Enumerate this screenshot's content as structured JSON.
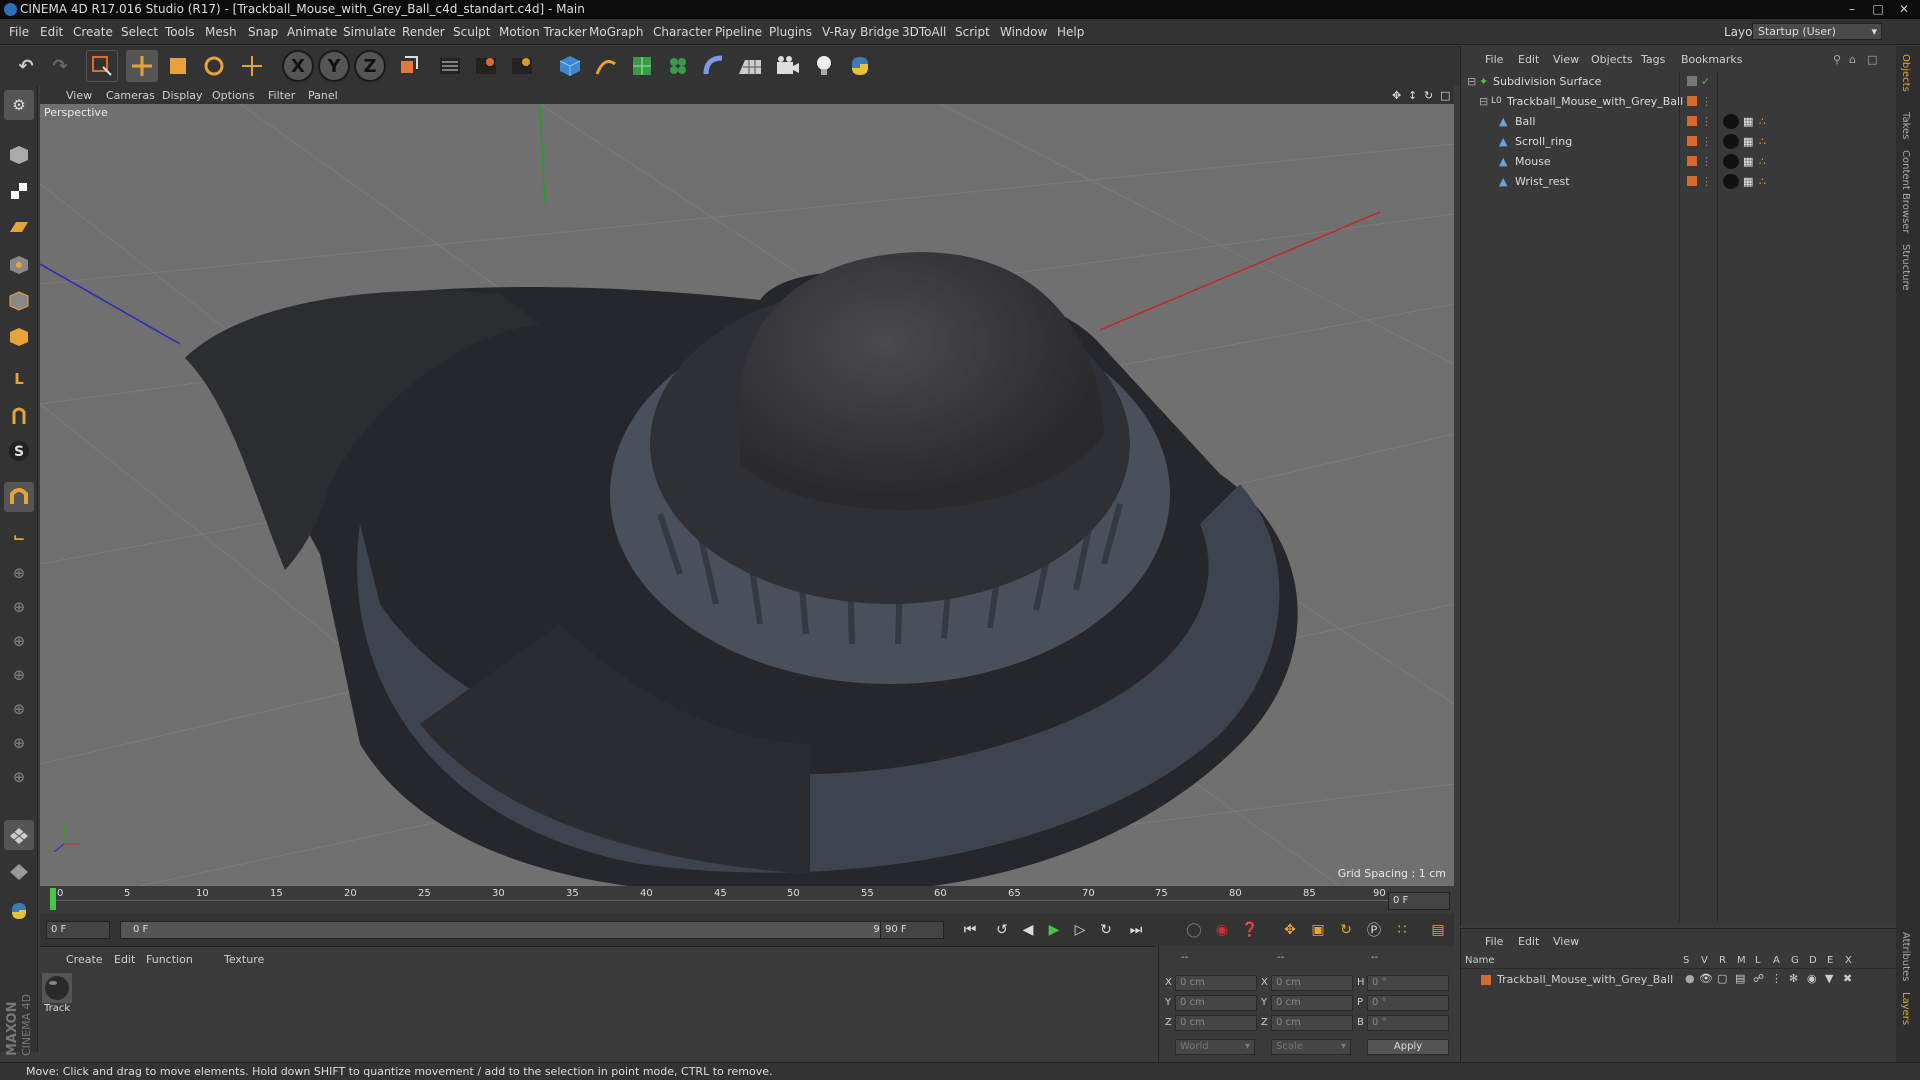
{
  "window": {
    "title": "CINEMA 4D R17.016 Studio (R17) - [Trackball_Mouse_with_Grey_Ball_c4d_standart.c4d] - Main",
    "controls": [
      "–",
      "□",
      "✕"
    ]
  },
  "menubar": {
    "items": [
      "File",
      "Edit",
      "Create",
      "Select",
      "Tools",
      "Mesh",
      "Snap",
      "Animate",
      "Simulate",
      "Render",
      "Sculpt",
      "Motion Tracker",
      "MoGraph",
      "Character",
      "Pipeline",
      "Plugins",
      "V-Ray Bridge",
      "3DToAll",
      "Script",
      "Window",
      "Help"
    ],
    "layout_label": "Layout:",
    "layout_value": "Startup (User)"
  },
  "toolbar": {
    "icons": [
      "undo-icon",
      "redo-icon",
      "live-selection-icon",
      "move-icon",
      "scale-icon",
      "rotate-icon",
      "move-tool-icon",
      "x-axis-icon",
      "y-axis-icon",
      "z-axis-icon",
      "coordinate-system-icon",
      "render-view-icon",
      "render-picture-viewer-icon",
      "edit-render-settings-icon",
      "cube-icon",
      "pen-spline-icon",
      "subdivision-icon",
      "cloner-icon",
      "deformer-icon",
      "floor-icon",
      "camera-icon",
      "light-icon",
      "python-icon"
    ],
    "axis_labels": [
      "X",
      "Y",
      "Z"
    ]
  },
  "viewport": {
    "menu": [
      "View",
      "Cameras",
      "Display",
      "Options",
      "Filter",
      "Panel"
    ],
    "camera_label": "Perspective",
    "grid_spacing": "Grid Spacing : 1 cm"
  },
  "timeline": {
    "ticks": [
      "0",
      "5",
      "10",
      "15",
      "20",
      "25",
      "30",
      "35",
      "40",
      "45",
      "50",
      "55",
      "60",
      "65",
      "70",
      "75",
      "80",
      "85",
      "90"
    ],
    "current_frame_display": "0 F"
  },
  "transport": {
    "start_field": "0 F",
    "slider_start": "0 F",
    "slider_end": "90 F",
    "end_field": "90 F"
  },
  "material_manager": {
    "menu": [
      "Create",
      "Edit",
      "Function",
      "Texture"
    ],
    "materials": [
      {
        "name": "Track"
      }
    ]
  },
  "coordinates": {
    "header": [
      "--",
      "--",
      "--"
    ],
    "rows": [
      {
        "axis": "X",
        "pos": "0 cm",
        "size_axis": "X",
        "size": "0 cm",
        "rot_axis": "H",
        "rot": "0 °"
      },
      {
        "axis": "Y",
        "pos": "0 cm",
        "size_axis": "Y",
        "size": "0 cm",
        "rot_axis": "P",
        "rot": "0 °"
      },
      {
        "axis": "Z",
        "pos": "0 cm",
        "size_axis": "Z",
        "size": "0 cm",
        "rot_axis": "B",
        "rot": "0 °"
      }
    ],
    "mode_select": "World",
    "scale_select": "Scale",
    "apply_label": "Apply"
  },
  "object_manager": {
    "menu": [
      "File",
      "Edit",
      "View",
      "Objects",
      "Tags",
      "Bookmarks"
    ],
    "objects": [
      {
        "name": "Subdivision Surface",
        "level": 0,
        "type": "subdivision"
      },
      {
        "name": "Trackball_Mouse_with_Grey_Ball",
        "level": 1,
        "type": "null"
      },
      {
        "name": "Ball",
        "level": 2,
        "type": "polygon"
      },
      {
        "name": "Scroll_ring",
        "level": 2,
        "type": "polygon"
      },
      {
        "name": "Mouse",
        "level": 2,
        "type": "polygon"
      },
      {
        "name": "Wrist_rest",
        "level": 2,
        "type": "polygon"
      }
    ]
  },
  "layer_manager": {
    "menu": [
      "File",
      "Edit",
      "View"
    ],
    "columns": [
      "Name",
      "S",
      "V",
      "R",
      "M",
      "L",
      "A",
      "G",
      "D",
      "E",
      "X"
    ],
    "layers": [
      {
        "name": "Trackball_Mouse_with_Grey_Ball",
        "color": "#d9682a"
      }
    ]
  },
  "right_tabs": [
    "Objects",
    "Takes",
    "Content Browser",
    "Structure",
    "Attributes",
    "Layers"
  ],
  "status": "Move: Click and drag to move elements. Hold down SHIFT to quantize movement / add to the selection in point mode, CTRL to remove.",
  "logo": {
    "text": "MAXON CINEMA 4D"
  },
  "colors": {
    "accent_orange": "#d9682a",
    "accent_blue": "#4a90d9",
    "play_green": "#46c646",
    "record_red": "#d23030"
  }
}
